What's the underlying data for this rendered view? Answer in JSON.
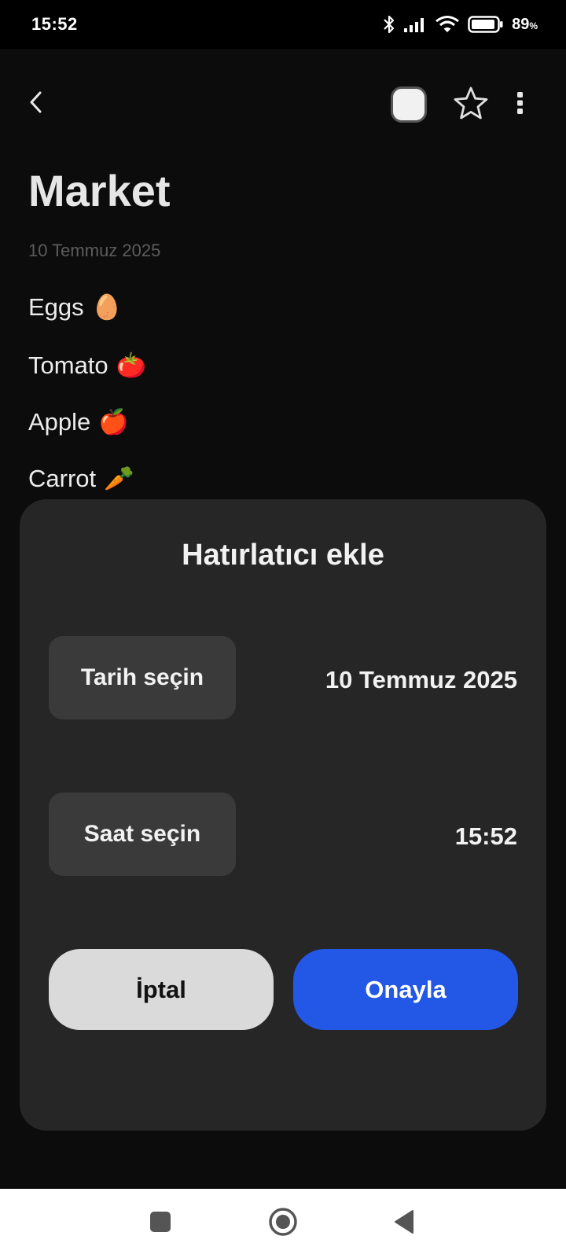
{
  "status_bar": {
    "time": "15:52",
    "battery_percent": "89",
    "battery_unit": "%",
    "icons": [
      "bluetooth-icon",
      "signal-icon",
      "wifi-icon",
      "battery-icon"
    ]
  },
  "app_bar": {
    "icons": [
      "back-arrow-icon",
      "color-swatch",
      "star-icon",
      "more-vert-icon"
    ],
    "swatch_color": "#f1f1f1"
  },
  "note": {
    "title": "Market",
    "date": "10 Temmuz 2025",
    "items": [
      {
        "text": "Eggs",
        "emoji": "🥚"
      },
      {
        "text": "Tomato",
        "emoji": "🍅"
      },
      {
        "text": "Apple",
        "emoji": "🍎"
      },
      {
        "text": "Carrot",
        "emoji": "🥕"
      }
    ]
  },
  "dialog": {
    "title": "Hatırlatıcı ekle",
    "date_button": "Tarih seçin",
    "date_value": "10 Temmuz 2025",
    "time_button": "Saat seçin",
    "time_value": "15:52",
    "cancel_label": "İptal",
    "confirm_label": "Onayla",
    "confirm_color": "#2357e6"
  },
  "nav_bar": {
    "icons": [
      "recents-square-icon",
      "home-circle-icon",
      "back-triangle-icon"
    ]
  }
}
